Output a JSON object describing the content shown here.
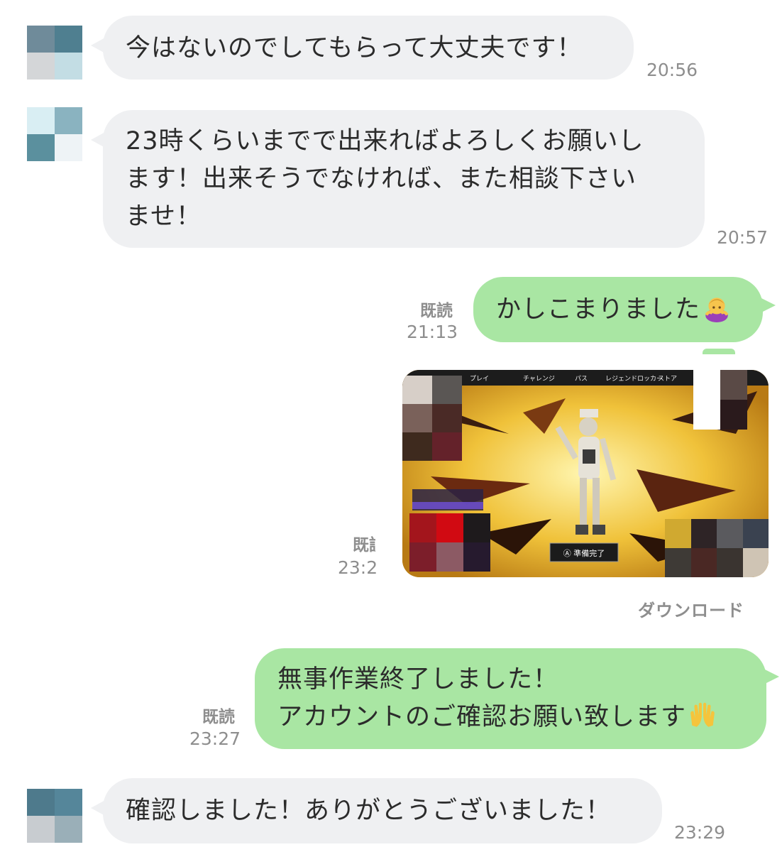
{
  "messages": [
    {
      "text": "今はないのでしてもらって大丈夫です！",
      "time": "20:56"
    },
    {
      "lines": [
        "23時くらいまでで出来ればよろしくお願いし",
        "ます！出来そうでなければ、また相談下さい",
        "ませ！"
      ],
      "time": "20:57"
    },
    {
      "text": "かしこまりました",
      "read": "既読",
      "time": "21:13",
      "emoji": "bowing-woman"
    },
    {
      "read": "既読",
      "time": "23:2",
      "download": "ダウンロード",
      "image": {
        "tabs": [
          "プレイ",
          "チャレンジ",
          "パス",
          "レジェンドロッカー",
          "ストア"
        ],
        "ready_label": "Ⓐ 準備完了"
      }
    },
    {
      "lines": [
        "無事作業終了しました！",
        "アカウントのご確認お願い致します"
      ],
      "read": "既読",
      "time": "23:27",
      "emoji": "raising-hands"
    },
    {
      "text": "確認しました！ありがとうございました！",
      "time": "23:29"
    }
  ],
  "colors": {
    "incoming_bubble": "#eff0f2",
    "outgoing_bubble": "#a9e6a3",
    "meta_text": "#8e8e8e"
  }
}
